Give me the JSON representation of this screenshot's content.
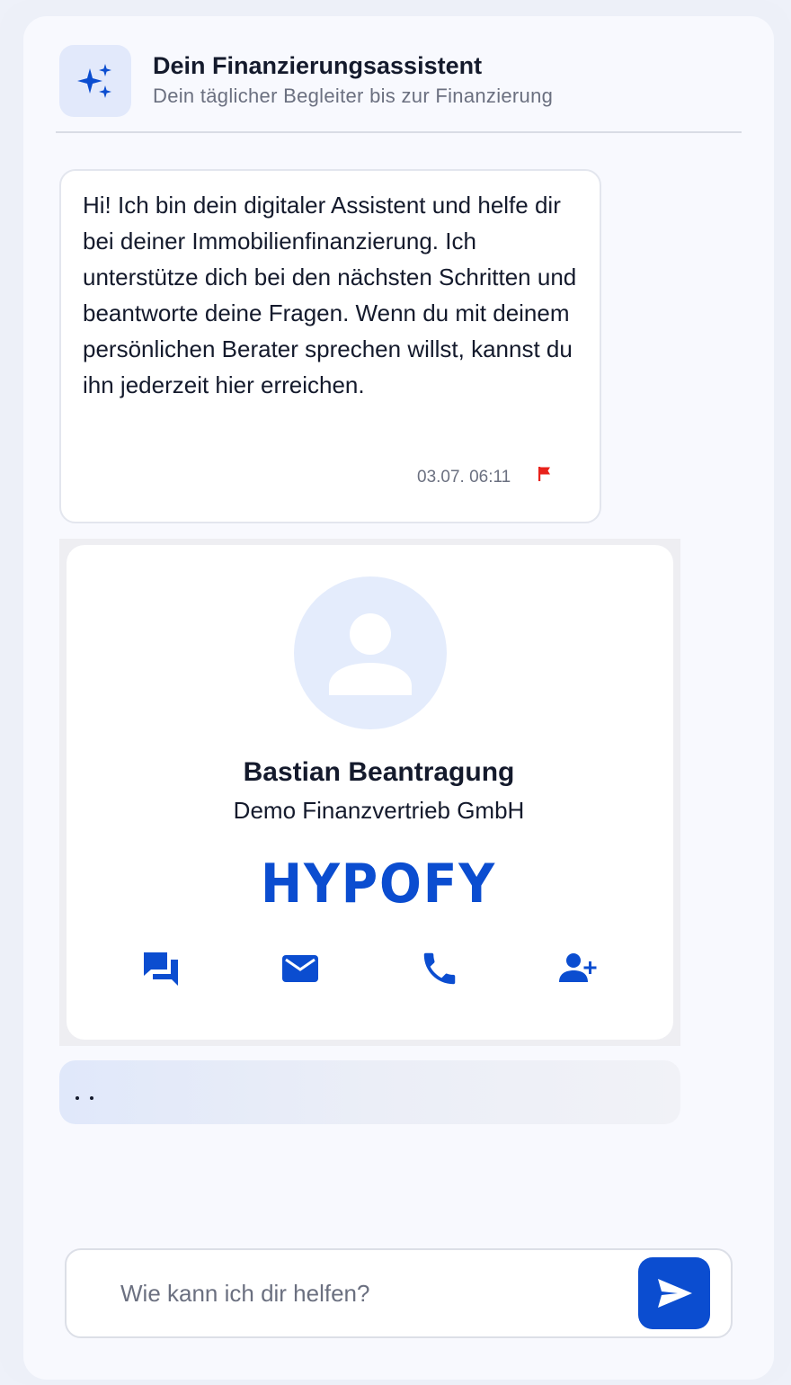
{
  "header": {
    "title": "Dein Finanzierungsassistent",
    "subtitle": "Dein täglicher Begleiter bis zur Finanzierung",
    "icon": "sparkles-icon"
  },
  "message": {
    "text": "Hi! Ich bin dein digitaler Assistent und helfe dir bei deiner Immobilienfinanzierung. Ich unterstütze dich bei den nächsten Schritten und beantworte deine Fragen. Wenn du mit deinem persönlichen Berater sprechen willst, kannst du ihn jederzeit hier erreichen.",
    "timestamp": "03.07. 06:11",
    "flag_icon": "flag-icon"
  },
  "contact": {
    "name": "Bastian Beantragung",
    "company": "Demo Finanzvertrieb GmbH",
    "brand": "HYPOFY",
    "actions": [
      "chat-icon",
      "mail-icon",
      "phone-icon",
      "add-person-icon"
    ]
  },
  "typing_indicator": "· ·",
  "input": {
    "placeholder": "Wie kann ich dir helfen?",
    "value": "",
    "send_icon": "send-icon"
  },
  "colors": {
    "accent": "#0b4dd0",
    "panel": "#f8f9fe",
    "avatar_bg": "#e4ecfc",
    "flag": "#e8221b"
  }
}
